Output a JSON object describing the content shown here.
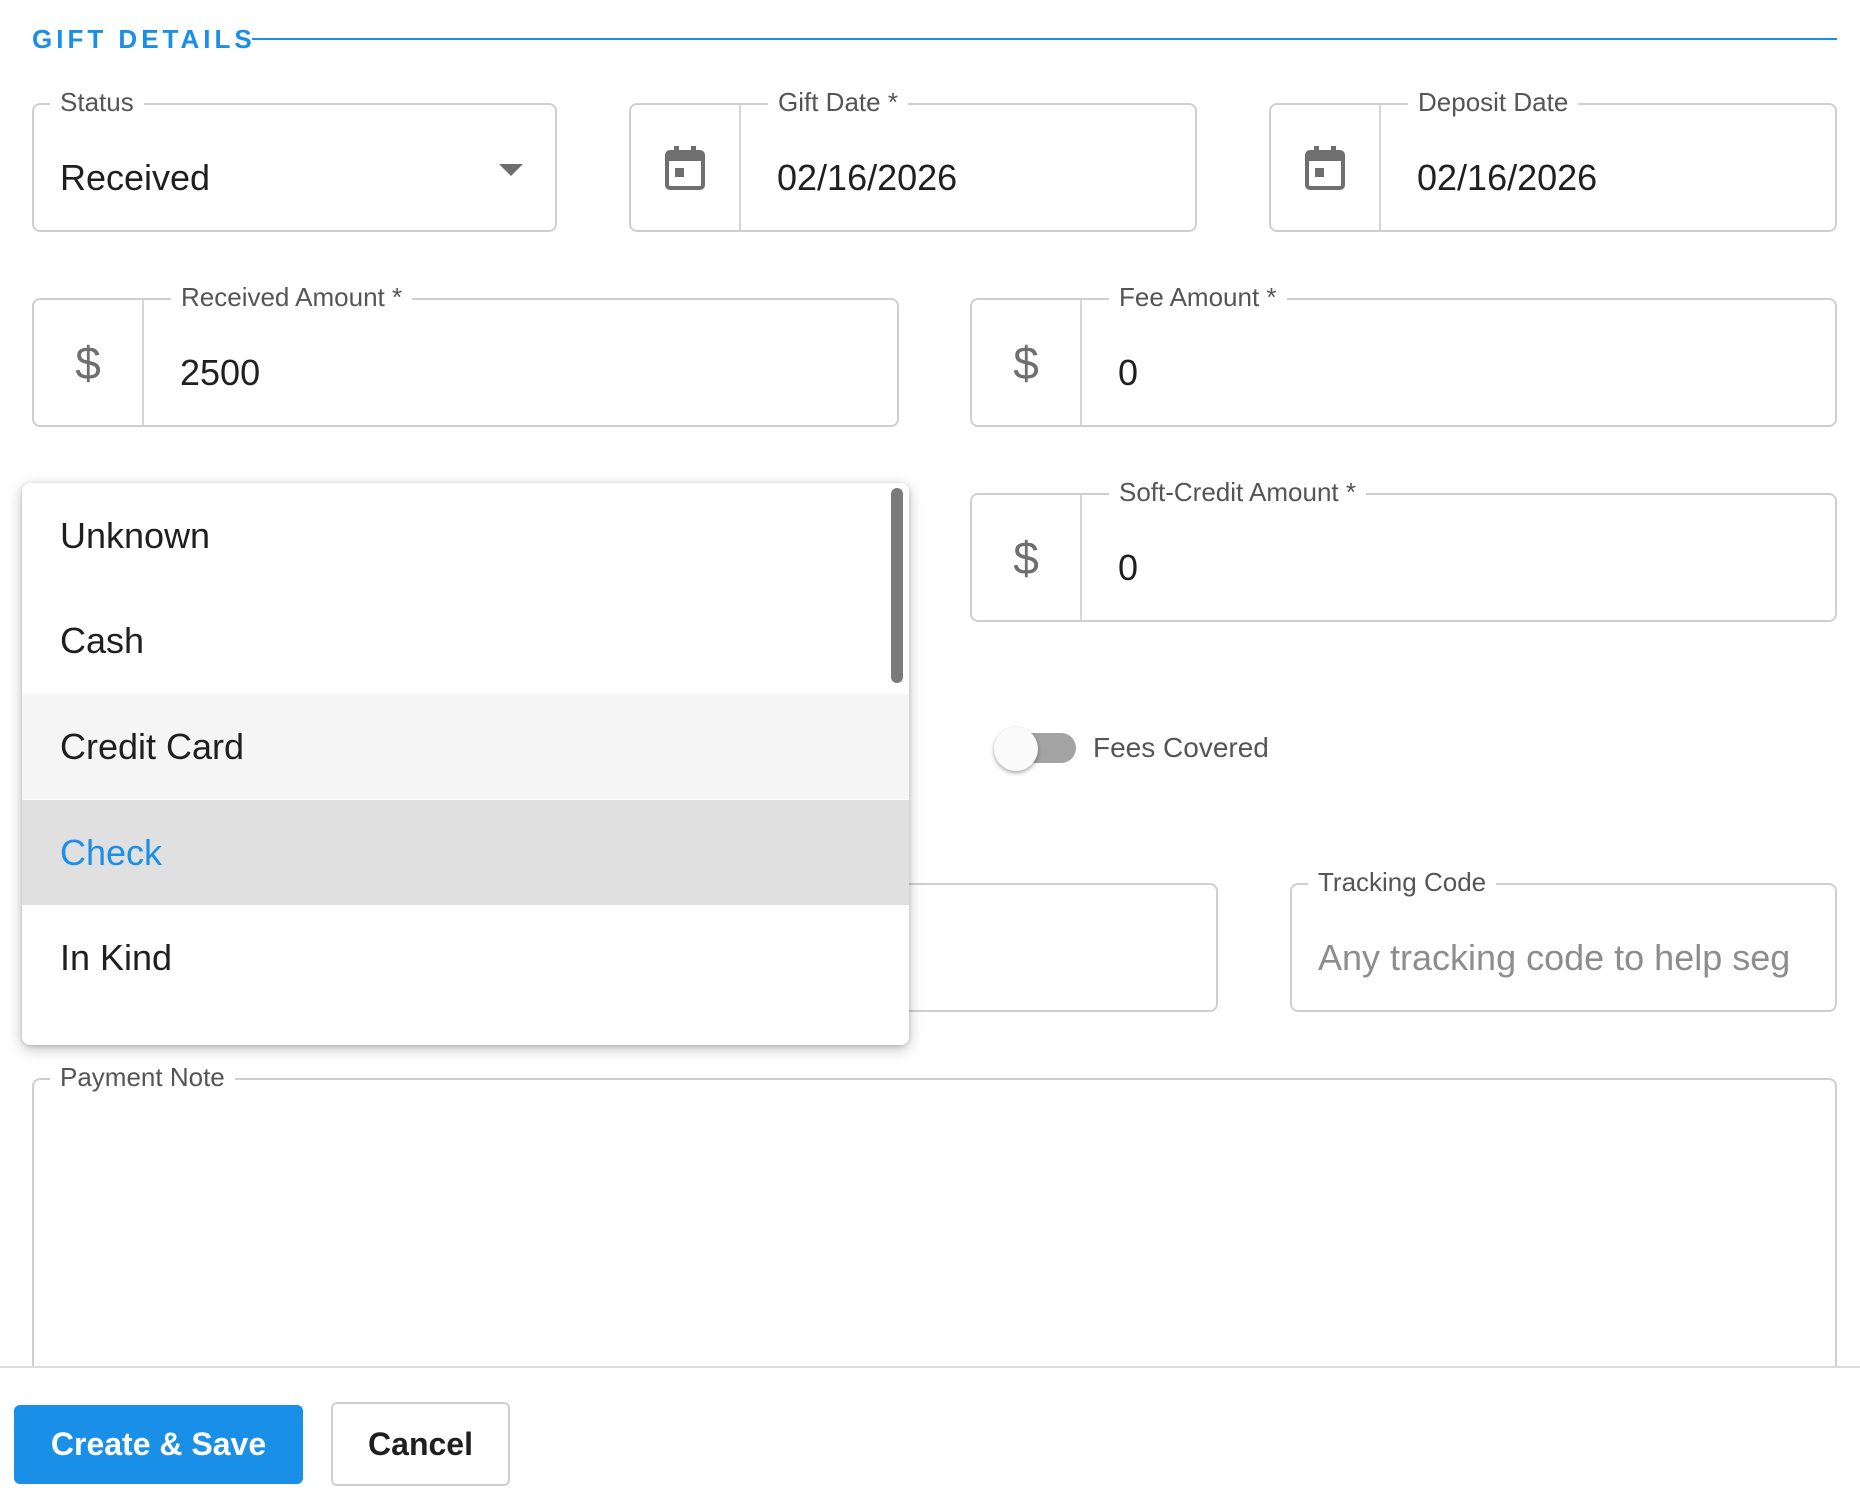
{
  "section": {
    "title": "GIFT DETAILS"
  },
  "status": {
    "label": "Status",
    "value": "Received"
  },
  "gift_date": {
    "label": "Gift Date *",
    "value": "02/16/2026"
  },
  "deposit_date": {
    "label": "Deposit Date",
    "value": "02/16/2026"
  },
  "received_amount": {
    "label": "Received Amount *",
    "currency": "$",
    "value": "2500"
  },
  "fee_amount": {
    "label": "Fee Amount *",
    "currency": "$",
    "value": "0"
  },
  "soft_credit_amount": {
    "label": "Soft-Credit Amount *",
    "currency": "$",
    "value": "0"
  },
  "fees_covered": {
    "label": "Fees Covered",
    "checked": false
  },
  "tracking_code": {
    "label": "Tracking Code",
    "placeholder": "Any tracking code to help seg"
  },
  "payment_note": {
    "label": "Payment Note",
    "value": ""
  },
  "payment_method_menu": {
    "items": [
      {
        "label": "Unknown"
      },
      {
        "label": "Cash"
      },
      {
        "label": "Credit Card"
      },
      {
        "label": "Check"
      },
      {
        "label": "In Kind"
      }
    ],
    "hovered": "Credit Card",
    "selected": "Check"
  },
  "actions": {
    "create_save": "Create & Save",
    "cancel": "Cancel"
  },
  "colors": {
    "accent": "#1a8fe8",
    "selected_bg": "#e0e0e0",
    "hover_bg": "#f5f5f5"
  },
  "icons": {
    "calendar": "calendar-icon",
    "dropdown": "chevron-down-icon"
  }
}
